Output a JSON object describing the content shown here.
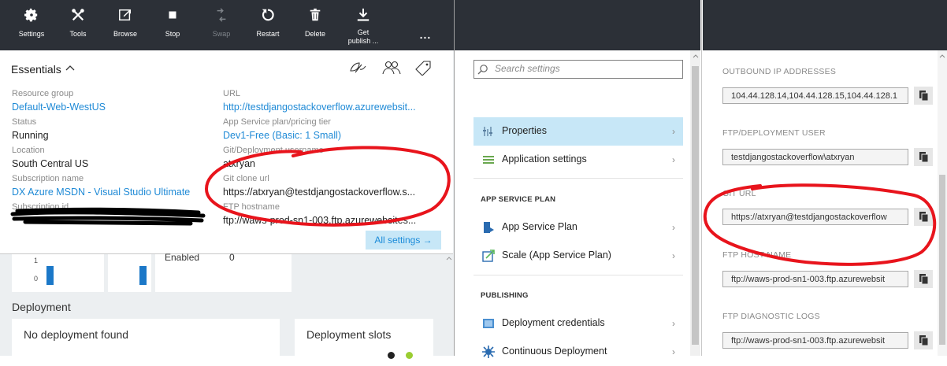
{
  "commands": [
    {
      "label": "Settings",
      "icon": "gear-icon"
    },
    {
      "label": "Tools",
      "icon": "tools-icon"
    },
    {
      "label": "Browse",
      "icon": "browse-icon"
    },
    {
      "label": "Stop",
      "icon": "stop-icon"
    },
    {
      "label": "Swap",
      "icon": "swap-icon",
      "disabled": true
    },
    {
      "label": "Restart",
      "icon": "restart-icon"
    },
    {
      "label": "Delete",
      "icon": "trash-icon"
    },
    {
      "label": "Get publish ...",
      "line1": "Get",
      "line2": "publish ...",
      "icon": "download-icon"
    }
  ],
  "more": "...",
  "essentials": {
    "title": "Essentials",
    "left": [
      {
        "label": "Resource group",
        "value": "Default-Web-WestUS",
        "link": true
      },
      {
        "label": "Status",
        "value": "Running"
      },
      {
        "label": "Location",
        "value": "South Central US"
      },
      {
        "label": "Subscription name",
        "value": "DX Azure MSDN - Visual Studio Ultimate",
        "link": true
      },
      {
        "label": "Subscription id",
        "value": ""
      }
    ],
    "right": [
      {
        "label": "URL",
        "value": "http://testdjangostackoverflow.azurewebsit...",
        "link": true
      },
      {
        "label": "App Service plan/pricing tier",
        "value": "Dev1-Free (Basic: 1 Small)",
        "link": true
      },
      {
        "label": "Git/Deployment username",
        "value": "atxryan"
      },
      {
        "label": "Git clone url",
        "value": "https://atxryan@testdjangostackoverflow.s..."
      },
      {
        "label": "FTP hostname",
        "value": "ftp://waws-prod-sn1-003.ftp.azurewebsites..."
      }
    ],
    "all_settings": "All settings →"
  },
  "metrics": {
    "tick_1": "1",
    "tick_0": "0",
    "enabled_label": "Enabled",
    "enabled_value": "0"
  },
  "deployment": {
    "title": "Deployment",
    "none": "No deployment found",
    "slots": "Deployment slots"
  },
  "settings_blade": {
    "search_placeholder": "Search settings",
    "items_top": [
      {
        "label": "Properties",
        "icon": "properties-icon",
        "selected": true
      },
      {
        "label": "Application settings",
        "icon": "app-settings-icon"
      }
    ],
    "section_plan": "APP SERVICE PLAN",
    "items_plan": [
      {
        "label": "App Service Plan",
        "icon": "app-service-plan-icon"
      },
      {
        "label": "Scale (App Service Plan)",
        "icon": "scale-icon"
      }
    ],
    "section_publishing": "PUBLISHING",
    "items_publishing": [
      {
        "label": "Deployment credentials",
        "icon": "credentials-icon"
      },
      {
        "label": "Continuous Deployment",
        "icon": "continuous-deployment-icon"
      }
    ]
  },
  "properties": [
    {
      "label": "OUTBOUND IP ADDRESSES",
      "value": "104.44.128.14,104.44.128.15,104.44.128.1"
    },
    {
      "label": "FTP/DEPLOYMENT USER",
      "value": "testdjangostackoverflow\\atxryan"
    },
    {
      "label": "GIT URL",
      "value": "https://atxryan@testdjangostackoverflow"
    },
    {
      "label": "FTP HOST NAME",
      "value": "ftp://waws-prod-sn1-003.ftp.azurewebsit"
    },
    {
      "label": "FTP DIAGNOSTIC LOGS",
      "value": "ftp://waws-prod-sn1-003.ftp.azurewebsit"
    }
  ],
  "colors": {
    "topbar": "#2c3037",
    "link": "#1f8ad6",
    "selected": "#c7e7f7",
    "annotation": "#e8141c",
    "chart_bar": "#1b78c8"
  }
}
